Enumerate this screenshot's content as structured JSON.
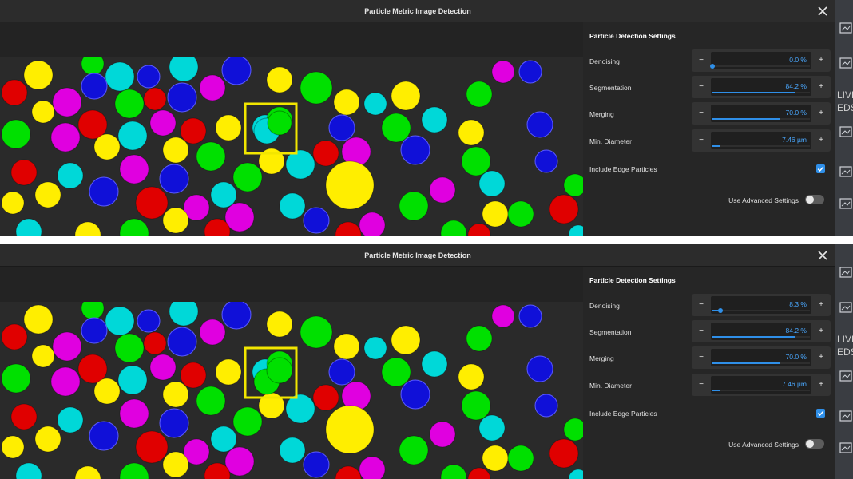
{
  "panels": [
    {
      "title": "Particle Metric Image Detection",
      "settings": {
        "title": "Particle Detection Settings",
        "rows": [
          {
            "label": "Denoising",
            "value": "0.0 %",
            "fill": 0.0
          },
          {
            "label": "Segmentation",
            "value": "84.2 %",
            "fill": 0.842
          },
          {
            "label": "Merging",
            "value": "70.0 %",
            "fill": 0.7
          },
          {
            "label": "Min. Diameter",
            "value": "7.46 µm",
            "fill": 0.07
          }
        ],
        "include_edge_label": "Include Edge Particles",
        "include_edge_checked": true,
        "advanced_label": "Use Advanced Settings",
        "advanced_on": false
      },
      "side_text": [
        "LIVE",
        "EDS"
      ],
      "highlight_separated": false
    },
    {
      "title": "Particle Metric Image Detection",
      "settings": {
        "title": "Particle Detection Settings",
        "rows": [
          {
            "label": "Denoising",
            "value": "8.3 %",
            "fill": 0.083
          },
          {
            "label": "Segmentation",
            "value": "84.2 %",
            "fill": 0.842
          },
          {
            "label": "Merging",
            "value": "70.0 %",
            "fill": 0.7
          },
          {
            "label": "Min. Diameter",
            "value": "7.46 µm",
            "fill": 0.07
          }
        ],
        "include_edge_label": "Include Edge Particles",
        "include_edge_checked": true,
        "advanced_label": "Use Advanced Settings",
        "advanced_on": false
      },
      "side_text": [
        "LIVE",
        "EDS"
      ],
      "highlight_separated": true
    }
  ],
  "colors": {
    "accent": "#2f8fe8",
    "highlight_box": "#f2e600",
    "particle_colors": [
      "#ffee00",
      "#00e000",
      "#1010d8",
      "#e000e0",
      "#00d8d8",
      "#e00000"
    ]
  }
}
